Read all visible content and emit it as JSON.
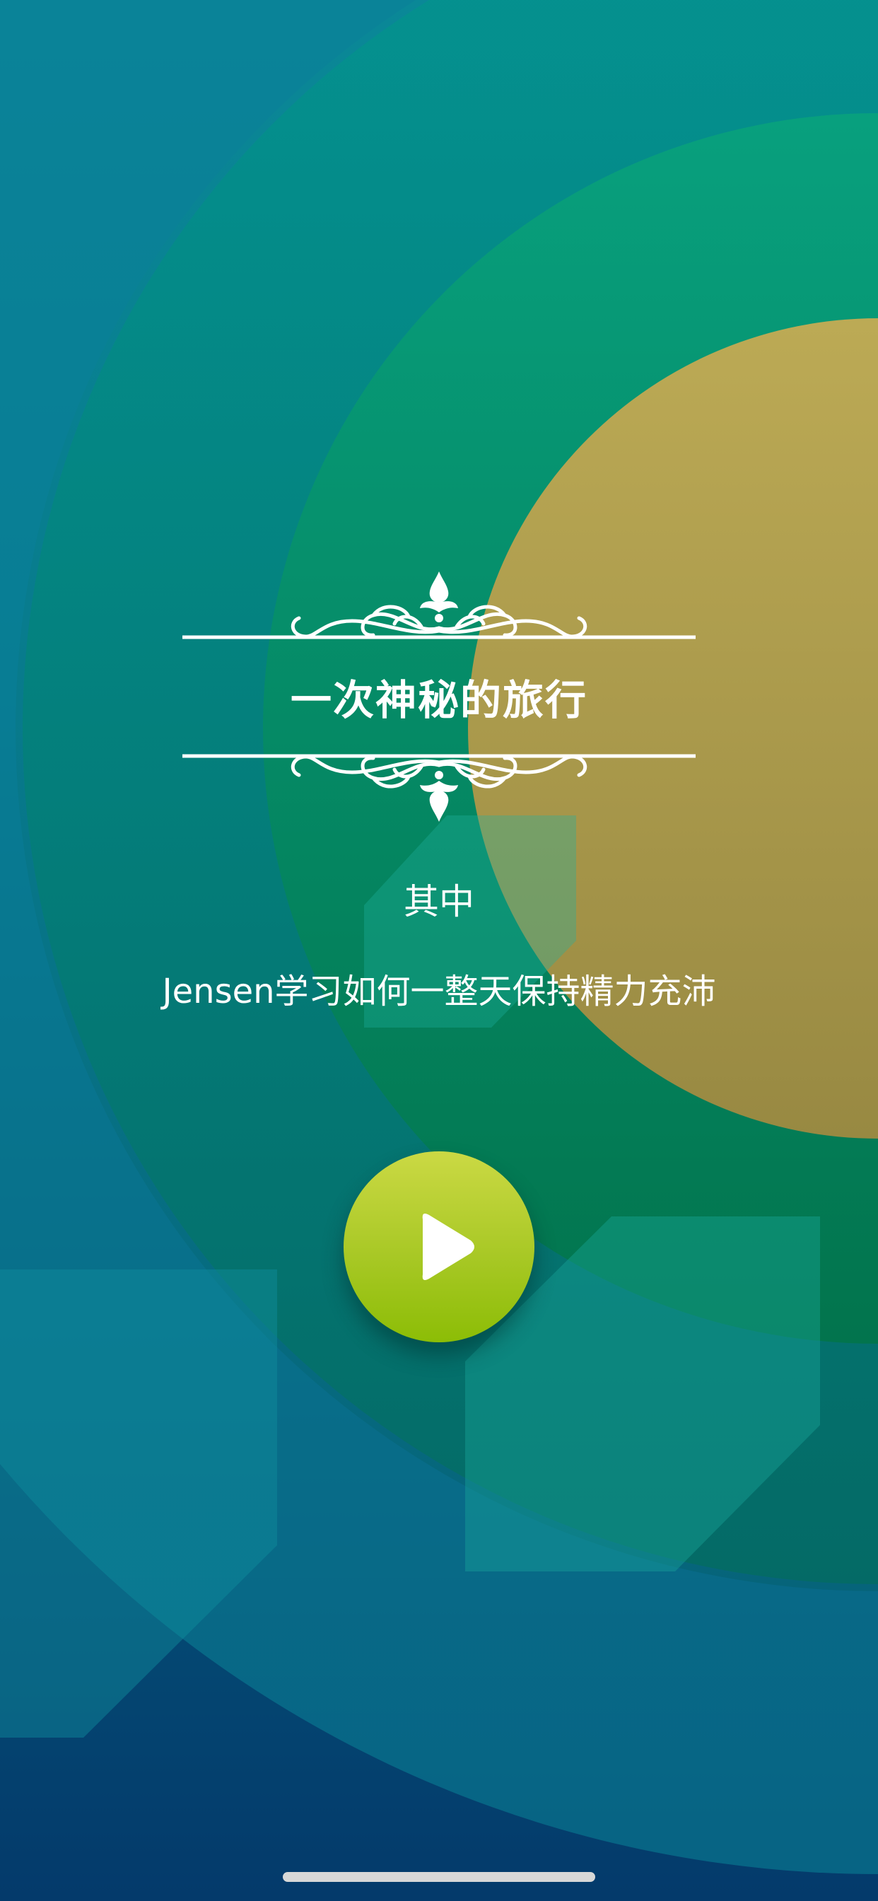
{
  "story": {
    "title": "一次神秘的旅行",
    "label": "其中",
    "description": "Jensen学习如何一整天保持精力充沛"
  },
  "icons": {
    "ornament": "filigree-ornament-icon",
    "play": "play-icon"
  },
  "colors": {
    "background_top": "#0b8a9e",
    "background_bottom": "#043a6b",
    "ring_green": "#058c5e",
    "sun_gold": "#b8a551",
    "play_button": "#a8c825",
    "text": "#ffffff"
  }
}
